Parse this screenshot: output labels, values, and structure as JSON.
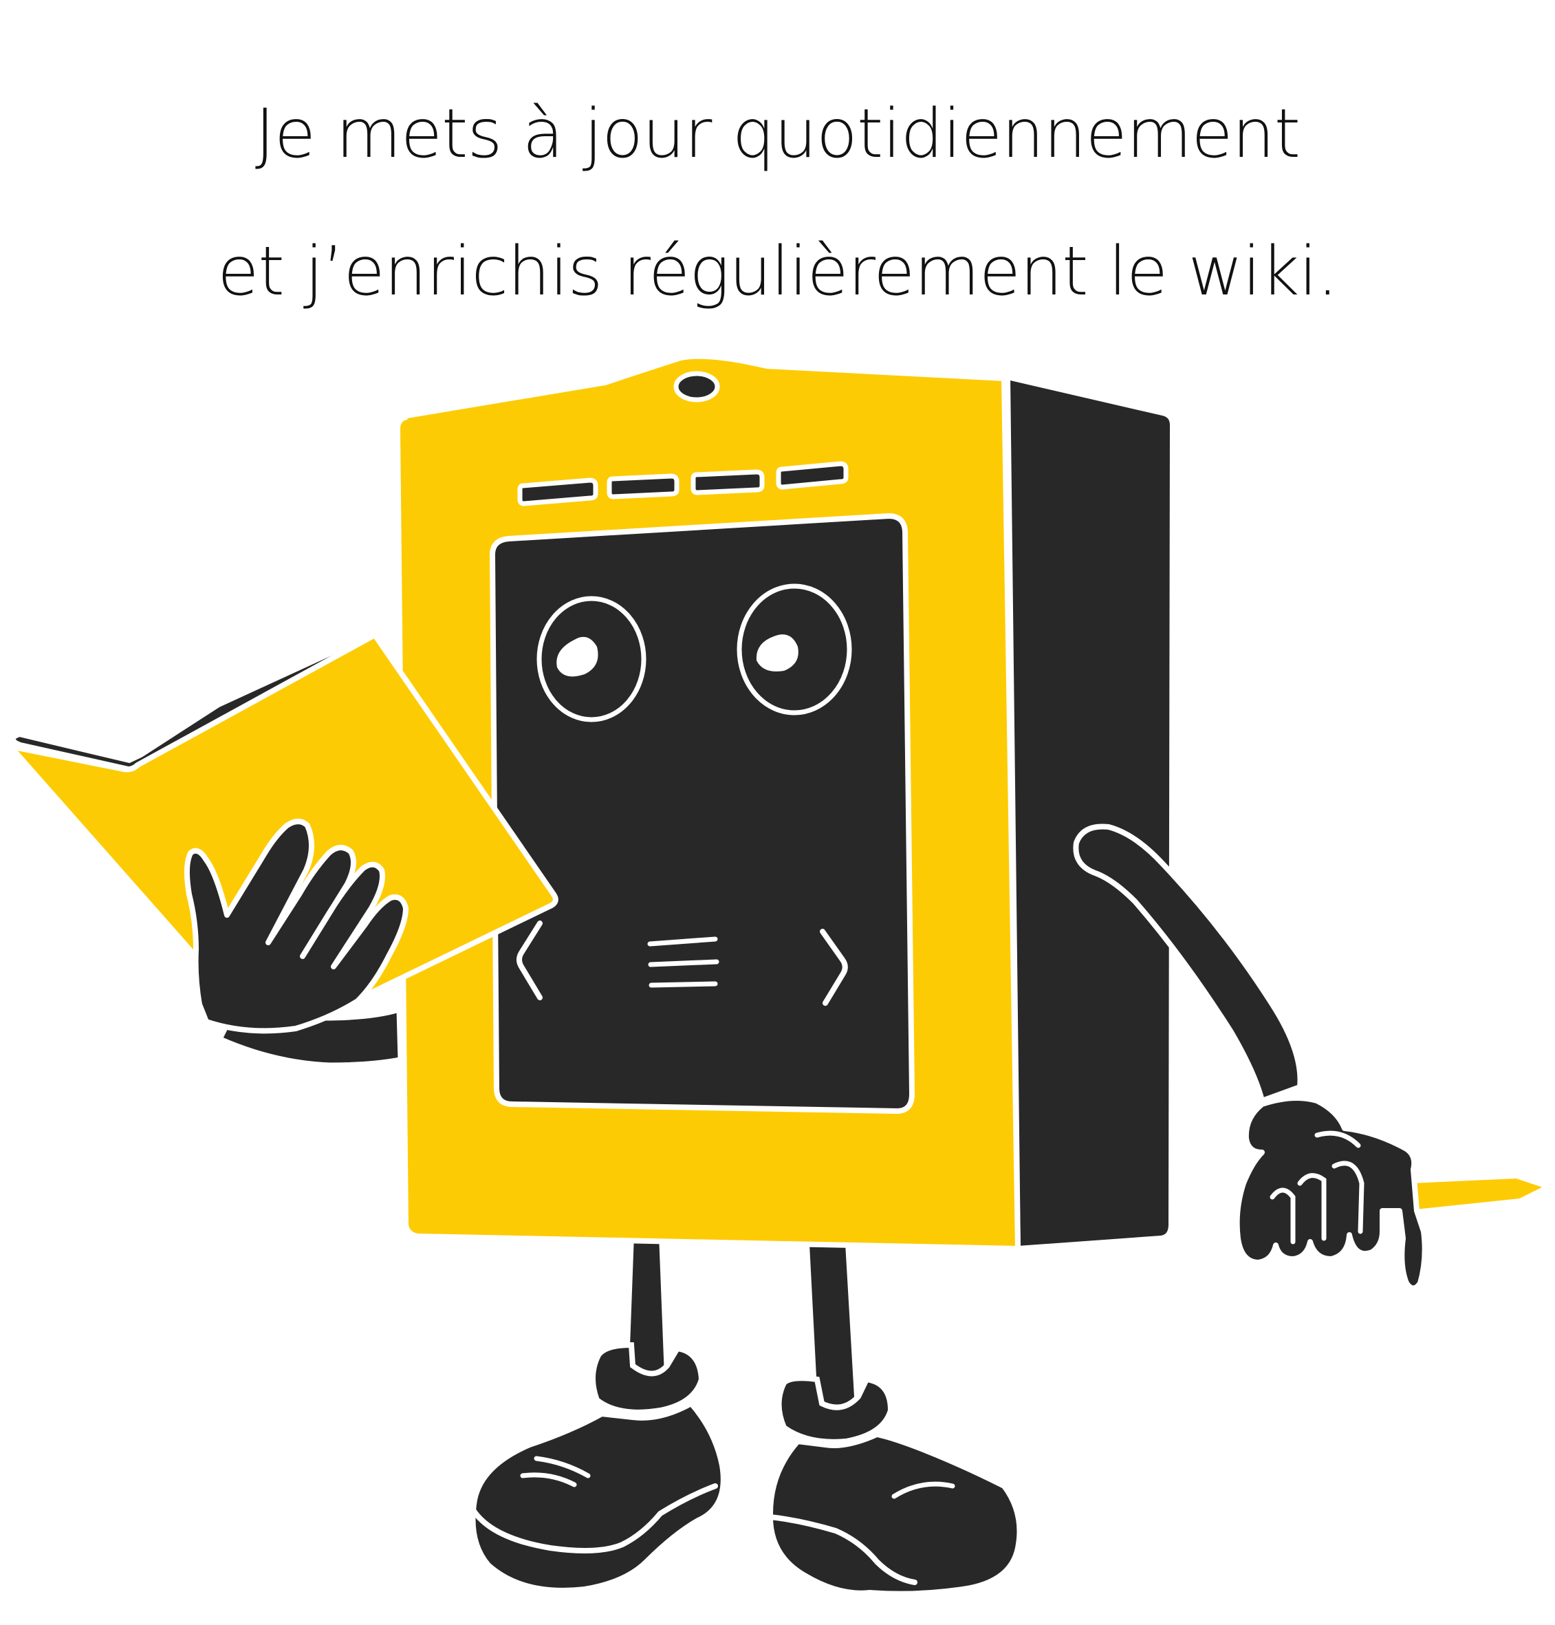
{
  "caption": {
    "line1": "Je mets à jour quotidiennement",
    "line2": "et j’enrichis régulièrement le wiki."
  },
  "illustration": {
    "icon": "robot-mascot-reading-book-holding-pencil-icon",
    "colors": {
      "yellow": "#FDCB04",
      "dark": "#282828",
      "outline": "#ffffff"
    }
  }
}
